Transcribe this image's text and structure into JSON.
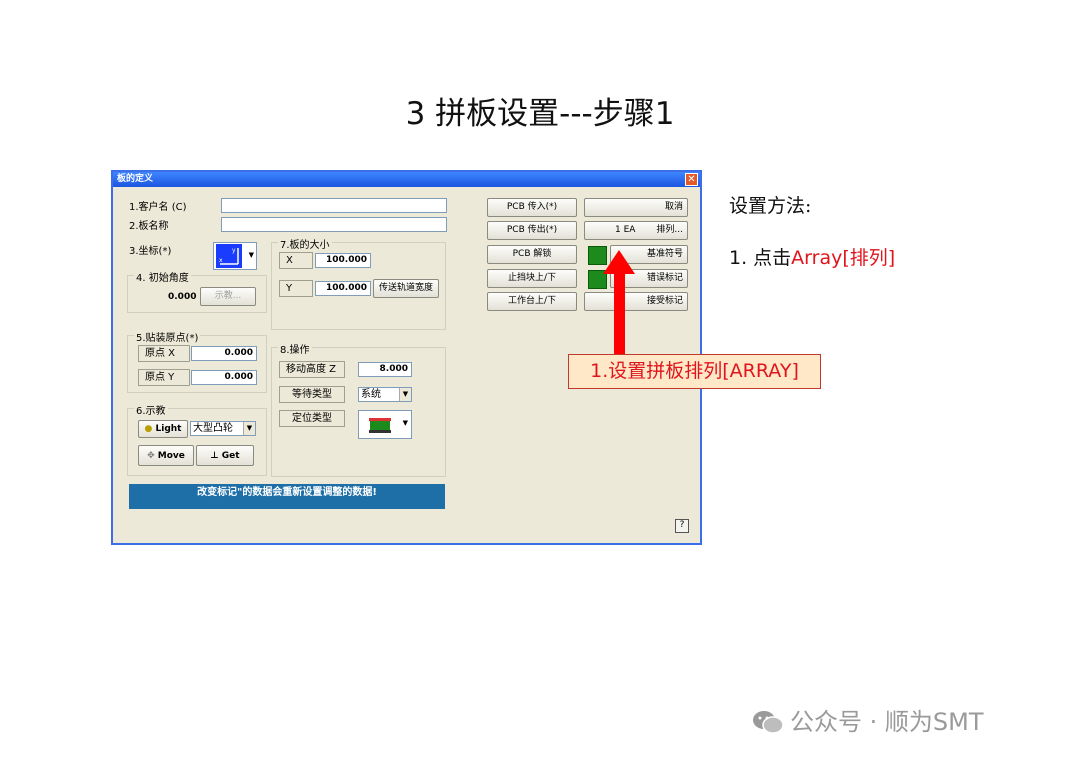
{
  "slide": {
    "title": "3  拼板设置---步骤1",
    "notes_heading": "设置方法:",
    "notes_step_prefix": "1. 点击",
    "notes_step_highlight": "Array[排列]"
  },
  "dialog": {
    "title": "板的定义",
    "customer_label": "1.客户名 (C)",
    "customer_value": "",
    "board_name_label": "2.板名称",
    "board_name_value": "",
    "coordinate_label": "3.坐标(*)",
    "initial_angle_group": "4. 初始角度",
    "initial_angle_value": "0.000",
    "show_button": "示教...",
    "board_size_group": "7.板的大小",
    "size_x_label": "X",
    "size_x_value": "100.000",
    "size_y_label": "Y",
    "size_y_value": "100.000",
    "conveyor_width_button": "传送轨道宽度",
    "origin_group": "5.贴装原点(*)",
    "origin_x_label": "原点 X",
    "origin_x_value": "0.000",
    "origin_y_label": "原点 Y",
    "origin_y_value": "0.000",
    "teach_group": "6.示教",
    "light_button": "Light",
    "lens_select": "大型凸轮",
    "move_button": "Move",
    "get_button": "Get",
    "operation_group": "8.操作",
    "move_height_label": "移动高度 Z",
    "move_height_value": "8.000",
    "wait_type_label": "等待类型",
    "wait_type_value": "系统",
    "position_type_label": "定位类型",
    "pcb_in_button": "PCB 传入(*)",
    "pcb_out_button": "PCB 传出(*)",
    "pcb_unlock_button": "PCB 解锁",
    "stopper_button": "止挡块上/下",
    "table_button": "工作台上/下",
    "cancel_button": "取消",
    "array_count": "1 EA",
    "array_button": "排列...",
    "fiducial_button": "基准符号",
    "bad_mark_button": "错误标记",
    "accept_mark_button": "接受标记",
    "status_text": "改变标记\"的数据会重新设置调整的数据!",
    "help_button": "?"
  },
  "annotation": {
    "callout": "1.设置拼板排列[ARRAY]"
  },
  "watermark": {
    "text": "公众号 · 顺为SMT"
  },
  "colors": {
    "accent_red": "#e0141c",
    "titlebar_blue": "#1a55e0",
    "status_blue": "#1e6ea8",
    "indicator_green": "#1c8a1c"
  }
}
